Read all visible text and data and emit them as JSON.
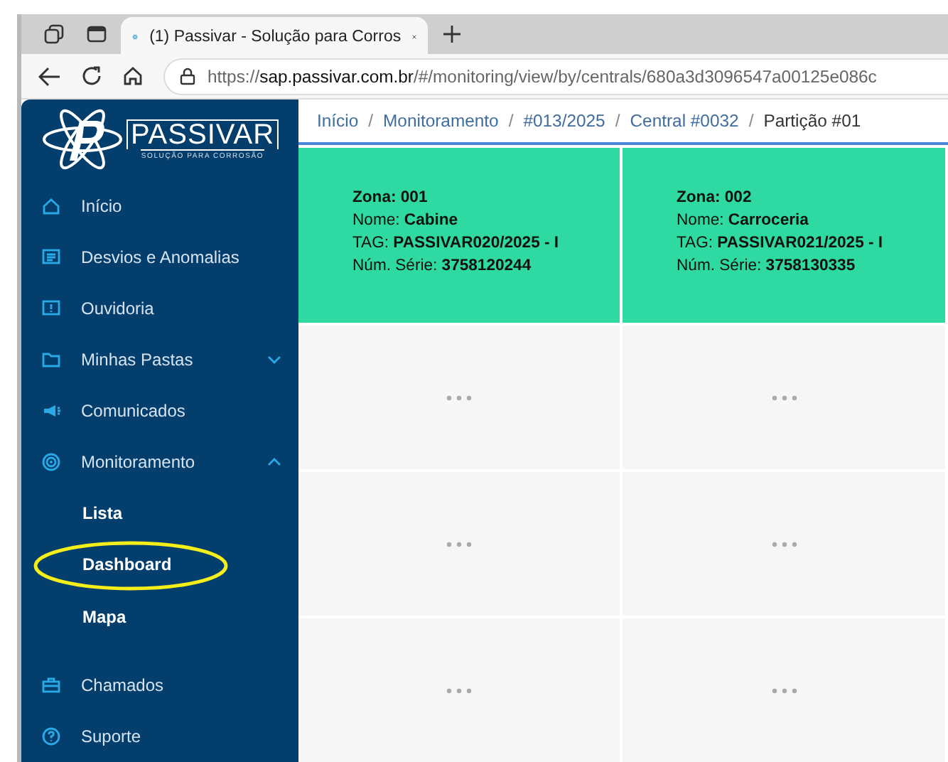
{
  "browser": {
    "tab_title": "(1) Passivar - Solução para Corros",
    "url": {
      "scheme": "https://",
      "host": "sap.passivar.com.br",
      "path": "/#/monitoring/view/by/centrals/680a3d3096547a00125e086c"
    }
  },
  "logo": {
    "name": "PASSIVAR",
    "tagline": "SOLUÇÃO PARA CORROSÃO"
  },
  "sidebar": {
    "items": [
      {
        "label": "Início"
      },
      {
        "label": "Desvios e Anomalias"
      },
      {
        "label": "Ouvidoria"
      },
      {
        "label": "Minhas Pastas",
        "expanded": false
      },
      {
        "label": "Comunicados"
      },
      {
        "label": "Monitoramento",
        "expanded": true,
        "children": [
          {
            "label": "Lista",
            "circled": false
          },
          {
            "label": "Dashboard",
            "circled": true
          },
          {
            "label": "Mapa",
            "circled": false
          }
        ]
      },
      {
        "label": "Chamados"
      },
      {
        "label": "Suporte"
      }
    ]
  },
  "breadcrumb": [
    {
      "kind": "link",
      "label": "Início"
    },
    {
      "kind": "separator",
      "label": "/"
    },
    {
      "kind": "link",
      "label": "Monitoramento"
    },
    {
      "kind": "separator",
      "label": "/"
    },
    {
      "kind": "link",
      "label": "#013/2025"
    },
    {
      "kind": "separator",
      "label": "/"
    },
    {
      "kind": "link",
      "label": "Central #0032"
    },
    {
      "kind": "separator",
      "label": "/"
    },
    {
      "kind": "current",
      "label": "Partição #01"
    }
  ],
  "cards": [
    {
      "kind": "zone",
      "title": "Zona: 001",
      "lines": [
        "Nome: **Cabine**",
        "TAG: **PASSIVAR020/2025 - I**",
        "Núm. Série: **3758120244**"
      ]
    },
    {
      "kind": "zone",
      "title": "Zona: 002",
      "lines": [
        "Nome: **Carroceria**",
        "TAG: **PASSIVAR021/2025 - I**",
        "Núm. Série: **3758130335**"
      ]
    },
    {
      "kind": "loading"
    },
    {
      "kind": "loading"
    },
    {
      "kind": "loading"
    },
    {
      "kind": "loading"
    },
    {
      "kind": "loading"
    },
    {
      "kind": "loading"
    }
  ]
}
